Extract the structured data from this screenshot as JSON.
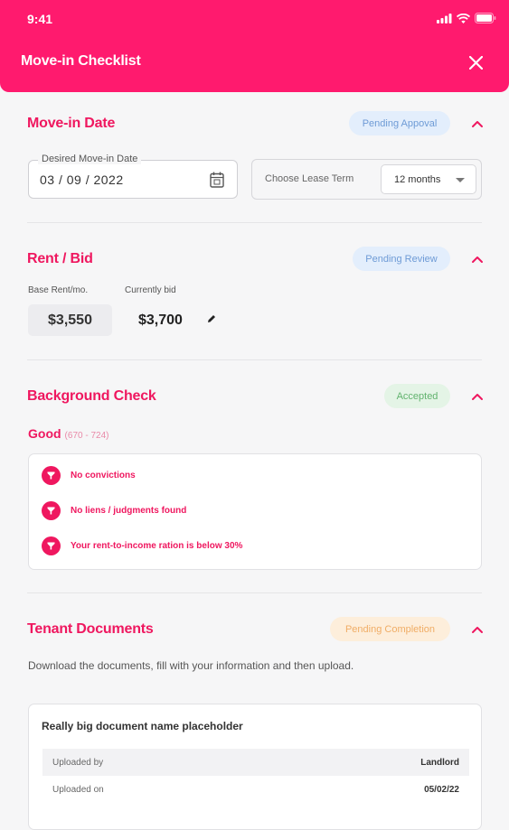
{
  "status_bar": {
    "time": "9:41"
  },
  "header": {
    "title": "Move-in Checklist"
  },
  "move_in": {
    "title": "Move-in Date",
    "badge": "Pending Appoval",
    "date_label": "Desired Move-in Date",
    "date_value": "03 / 09 / 2022",
    "lease_label": "Choose Lease Term",
    "lease_value": "12 months"
  },
  "rent": {
    "title": "Rent / Bid",
    "badge": "Pending Review",
    "base_label": "Base Rent/mo.",
    "base_value": "$3,550",
    "bid_label": "Currently bid",
    "bid_value": "$3,700"
  },
  "background": {
    "title": "Background Check",
    "badge": "Accepted",
    "rating": "Good",
    "range": "(670 - 724)",
    "items": [
      "No convictions",
      "No liens / judgments found",
      "Your rent-to-income ration is below 30%"
    ]
  },
  "documents": {
    "title": "Tenant Documents",
    "badge": "Pending Completion",
    "description": "Download the documents, fill with your information and then upload.",
    "doc_name": "Really big document name placeholder",
    "rows": [
      {
        "label": "Uploaded by",
        "value": "Landlord"
      },
      {
        "label": "Uploaded on",
        "value": "05/02/22"
      }
    ]
  },
  "colors": {
    "brand": "#ff1a6e",
    "accent_text": "#ef175f",
    "badge_blue": "#e3eefc",
    "badge_green": "#e4f4e6",
    "badge_orange": "#fdeedb"
  },
  "icons": [
    "signal-icon",
    "wifi-icon",
    "battery-icon",
    "close-icon",
    "chevron-up-icon",
    "calendar-icon",
    "chevron-down-icon",
    "pencil-icon",
    "check-badge-icon"
  ]
}
